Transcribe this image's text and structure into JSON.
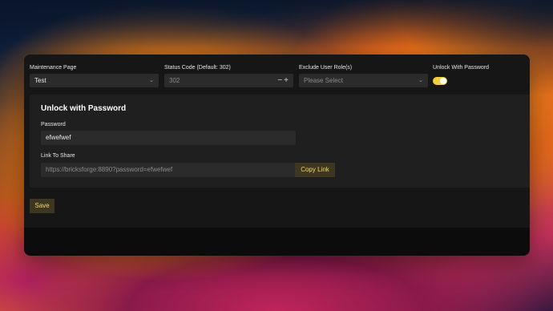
{
  "maintenance_page": {
    "label": "Maintenance Page",
    "value": "Test",
    "chevron_icon": "chevron-down"
  },
  "status_code": {
    "label": "Status Code (Default: 302)",
    "placeholder": "302",
    "minus": "−",
    "plus": "+"
  },
  "exclude_roles": {
    "label": "Exclude User Role(s)",
    "placeholder": "Please Select",
    "chevron_icon": "chevron-down"
  },
  "unlock_toggle": {
    "label": "Unlock With Password",
    "enabled": true,
    "color": "#f2cf3a"
  },
  "unlock_section": {
    "title": "Unlock with Password",
    "password_label": "Password",
    "password_value": "efwefwef",
    "link_label": "Link To Share",
    "link_value": "https://bricksforge:8890?password=efwefwef",
    "copy_button": "Copy Link"
  },
  "save_button": "Save",
  "colors": {
    "accent": "#f5d76a",
    "button_bg": "#3d3620",
    "panel_bg": "#161616",
    "input_bg": "#2b2b2b"
  }
}
